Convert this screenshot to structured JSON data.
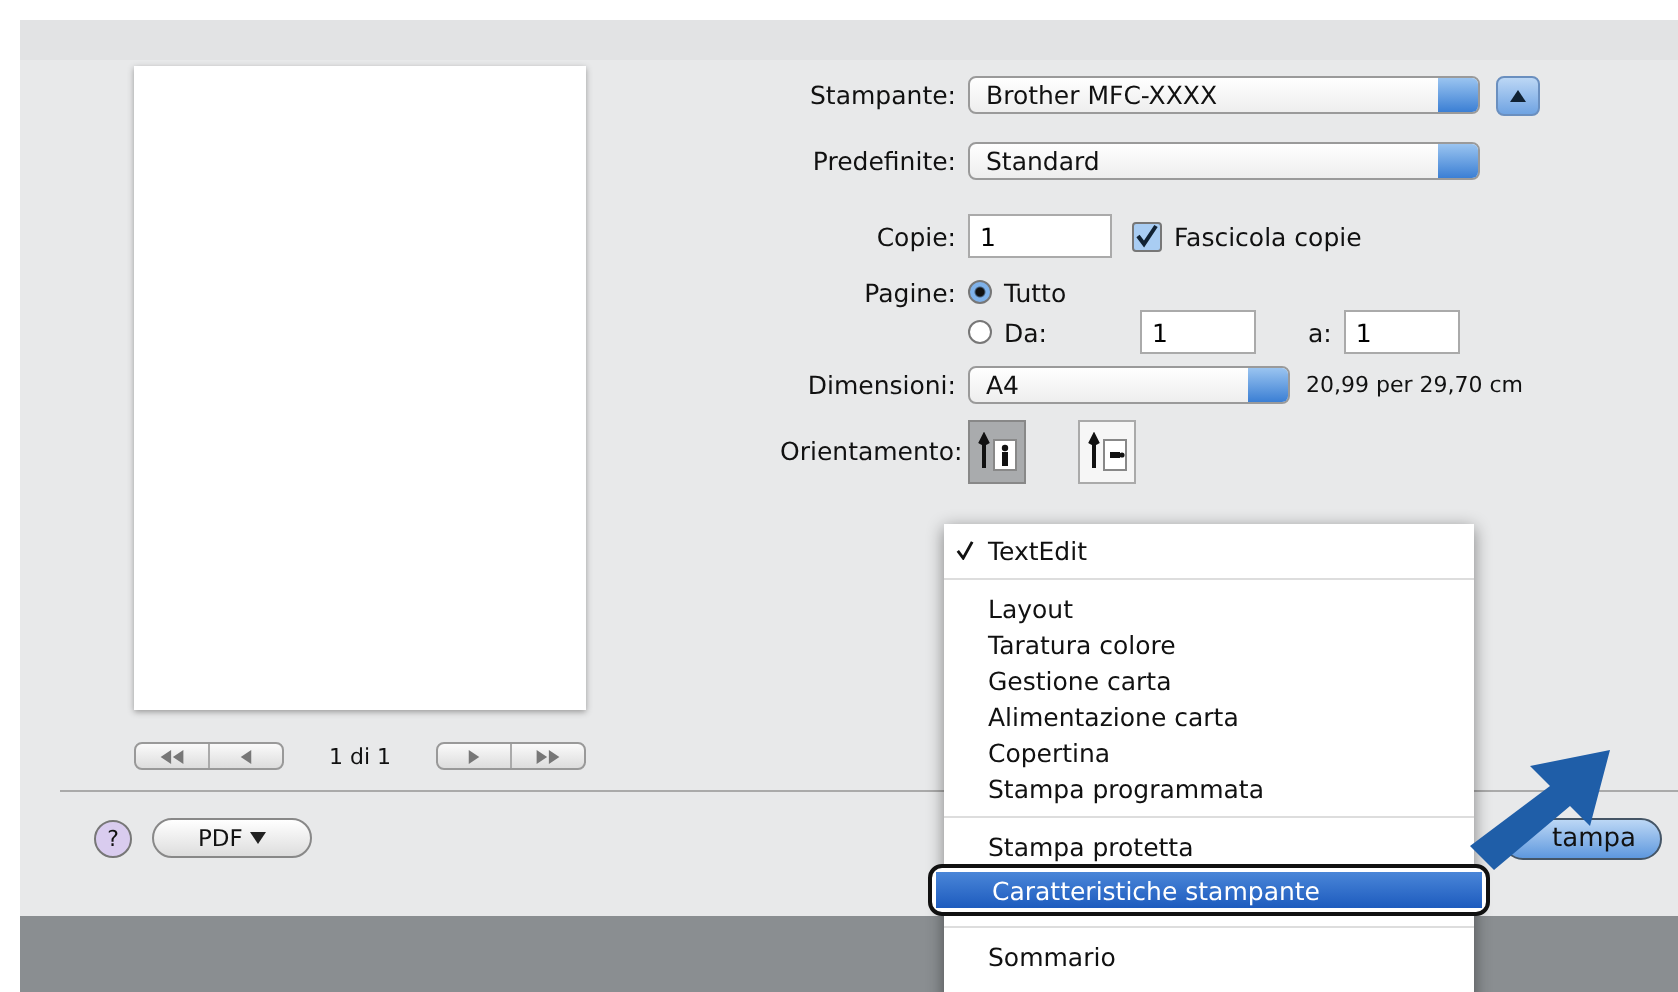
{
  "form": {
    "printer": {
      "label": "Stampante:",
      "value": "Brother MFC-XXXX"
    },
    "presets": {
      "label": "Predefinite:",
      "value": "Standard"
    },
    "copies": {
      "label": "Copie:",
      "value": "1",
      "collate": {
        "label": "Fascicola copie",
        "checked": true
      }
    },
    "pages": {
      "label": "Pagine:",
      "options": [
        {
          "label": "Tutto",
          "selected": true
        },
        {
          "label": "Da:",
          "selected": false
        }
      ],
      "from": "1",
      "to_label": "a:",
      "to": "1"
    },
    "size": {
      "label": "Dimensioni:",
      "value": "A4",
      "note": "20,99 per 29,70 cm"
    },
    "orientation": {
      "label": "Orientamento:",
      "options": [
        {
          "kind": "portrait",
          "selected": true
        },
        {
          "kind": "landscape",
          "selected": false
        }
      ]
    }
  },
  "preview": {
    "page_count": "1 di 1"
  },
  "bottom": {
    "help": "?",
    "pdf": "PDF",
    "print": "tampa"
  },
  "menu": {
    "items": [
      {
        "kind": "item",
        "label": "TextEdit",
        "checked": true,
        "selected": false
      },
      {
        "kind": "separator"
      },
      {
        "kind": "item",
        "label": "Layout",
        "checked": false,
        "selected": false
      },
      {
        "kind": "item",
        "label": "Taratura colore",
        "checked": false,
        "selected": false
      },
      {
        "kind": "item",
        "label": "Gestione carta",
        "checked": false,
        "selected": false
      },
      {
        "kind": "item",
        "label": "Alimentazione carta",
        "checked": false,
        "selected": false
      },
      {
        "kind": "item",
        "label": "Copertina",
        "checked": false,
        "selected": false
      },
      {
        "kind": "item",
        "label": "Stampa programmata",
        "checked": false,
        "selected": false
      },
      {
        "kind": "separator"
      },
      {
        "kind": "item",
        "label": "Stampa protetta",
        "checked": false,
        "selected": false
      },
      {
        "kind": "item",
        "label": "Caratteristiche stampante",
        "checked": false,
        "selected": true
      },
      {
        "kind": "separator"
      },
      {
        "kind": "item",
        "label": "Sommario",
        "checked": false,
        "selected": false
      }
    ]
  }
}
